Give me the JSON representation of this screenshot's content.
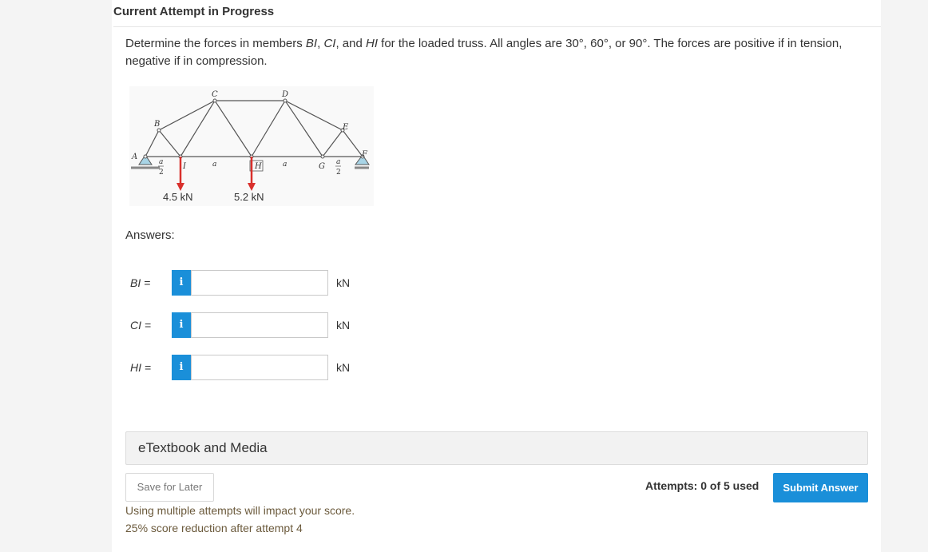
{
  "header": {
    "title": "Current Attempt in Progress"
  },
  "question": {
    "text_1": "Determine the forces in members ",
    "member_1": "BI",
    "text_2": ", ",
    "member_2": "CI",
    "text_3": ", and ",
    "member_3": "HI",
    "text_4": " for the loaded truss. All angles are 30°, 60°, or 90°. The forces are positive if in tension, negative if in compression."
  },
  "figure": {
    "joints": {
      "A": "A",
      "B": "B",
      "C": "C",
      "D": "D",
      "E": "E",
      "F": "F",
      "G": "G",
      "H": "H",
      "I": "I"
    },
    "dims": {
      "a": "a",
      "num": "a",
      "den": "2"
    },
    "loads": {
      "load_1": "4.5 kN",
      "load_2": "5.2 kN"
    },
    "colors": {
      "load_arrow": "#d9302c",
      "support": "#a8d4e6"
    }
  },
  "answers": {
    "label": "Answers:",
    "rows": [
      {
        "label": "BI =",
        "value": "",
        "unit": "kN"
      },
      {
        "label": "CI =",
        "value": "",
        "unit": "kN"
      },
      {
        "label": "HI =",
        "value": "",
        "unit": "kN"
      }
    ],
    "info_glyph": "i"
  },
  "etextbook": {
    "label": "eTextbook and Media"
  },
  "actions": {
    "save_label": "Save for Later",
    "attempts_label": "Attempts: 0 of 5 used",
    "submit_label": "Submit Answer"
  },
  "warnings": {
    "line_1": "Using multiple attempts will impact your score.",
    "line_2": "25% score reduction after attempt 4"
  },
  "colors": {
    "accent": "#1a8fd9",
    "warning_text": "#6b5a3c"
  }
}
